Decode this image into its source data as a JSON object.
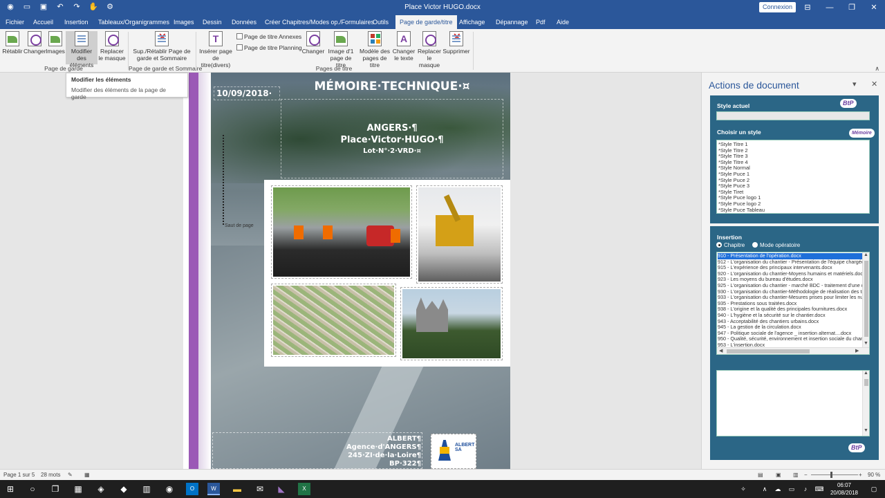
{
  "window": {
    "title": "Place Victor HUGO.docx",
    "connexion_label": "Connexion",
    "min": "—",
    "restore": "❐",
    "close": "✕",
    "ribbon_opts": "⊟"
  },
  "qat": {
    "autosave": "◉",
    "open": "▭",
    "save": "▣",
    "undo": "↶",
    "redo": "↷",
    "touch": "✋",
    "extra": "⚙"
  },
  "tabs": [
    "Fichier",
    "Accueil",
    "Insertion",
    "Tableaux/Organigrammes",
    "Images",
    "Dessin",
    "Données",
    "Créer Chapitres/Modes op./Formulaires",
    "Outils",
    "Page de garde/titre",
    "Affichage",
    "Dépannage",
    "Pdf",
    "Aide"
  ],
  "ribbon": {
    "retablir": "Rétablir",
    "changer": "Changer",
    "images": "Images",
    "modifier_1": "Modifier des",
    "modifier_2": "éléments",
    "replacer_1": "Replacer",
    "replacer_2": "le masque",
    "group1": "Page de garde",
    "sup_1": "Sup./Rétablir Page de",
    "sup_2": "garde et Sommaire",
    "group2": "Page de garde et Sommaire",
    "inserer_1": "Insérer page",
    "inserer_2": "de titre(divers)",
    "pt_annexes": "Page de titre Annexes",
    "pt_planning": "Page de titre Planning",
    "changer2": "Changer",
    "image1_1": "Image d'1",
    "image1_2": "page de titre",
    "modele_1": "Modèle des",
    "modele_2": "pages de titre",
    "changer_texte_1": "Changer",
    "changer_texte_2": "le texte",
    "replacer2_1": "Replacer",
    "replacer2_2": "le masque",
    "supprimer": "Supprimer",
    "group3": "Pages de titre",
    "collapse": "∧"
  },
  "tooltip": {
    "title": "Modifier les éléments",
    "body": "Modifier des éléments de la page de garde"
  },
  "document": {
    "date": "10/09/2018·",
    "title": "MÉMOIRE·TECHNIQUE·¤",
    "city": "ANGERS·¶",
    "place": "Place·Victor·HUGO·¶",
    "lot": "Lot·N°·2·VRD·¤",
    "page_label": "Saut de page",
    "mark_x": "¤",
    "addr_1": "ALBERT¶",
    "addr_2": "Agence·d'ANGERS¶",
    "addr_3": "245·ZI·de·la·Loire¶",
    "addr_4": "BP·322¶",
    "logo_text": "ALBERT SA"
  },
  "pane": {
    "title": "Actions de document",
    "dropdown": "▾",
    "close": "✕",
    "style_actuel": "Style actuel",
    "choisir": "Choisir un style",
    "badge1": "BtP",
    "badge2": "Mémoire",
    "badge3": "BtP",
    "styles": [
      "*Style Titre 1",
      "*Style Titre 2",
      "*Style Titre 3",
      "*Style Titre 4",
      "*Style Normal",
      "*Style Puce 1",
      "*Style Puce 2",
      "*Style Puce 3",
      "*Style Tiret",
      "*Style Puce logo 1",
      "*Style Puce logo 2",
      "*Style Puce Tableau"
    ],
    "insertion": "Insertion",
    "radio_chapitre": "Chapitre",
    "radio_mode": "Mode opératoire",
    "chapters": [
      "910 - Présentation de l'opération.docx",
      "912 - L'organisation du chantier - Présentation de l'équipe chargée",
      "915 - L'expérience des principaux intervenants.docx",
      "920 - L'organisation du chantier-Moyens humains et matériels.docx",
      "923 - Les moyens du bureau d'études.docx",
      "925 - L'organisation du chantier - marché BDC - traitement d'une d",
      "930 - L'organisation du chantier-Méthodologie de réalisation des tr",
      "933 - L'organisation du chantier-Mesures prises pour limiter les nuis",
      "935 - Prestations sous traitées.docx",
      "938 - L'origine et la qualité des principales fournitures.docx",
      "940 - L'hygiène et la sécurité sur le chantier.docx",
      "943 - Acceptabilité des chantiers urbains.docx",
      "945 - La gestion de la circulation.docx",
      "947 - Politique sociale de l'agence _ insertion alternat....docx",
      "950 - Qualité, sécurité, environnement et insertion sociale du chan",
      "953 - L'insertion.docx"
    ]
  },
  "status": {
    "page": "Page 1 sur 5",
    "words": "28 mots",
    "zoom": "90 %"
  },
  "taskbar": {
    "start": "⊞",
    "search": "○",
    "time": "06:07",
    "date": "20/08/2018"
  }
}
